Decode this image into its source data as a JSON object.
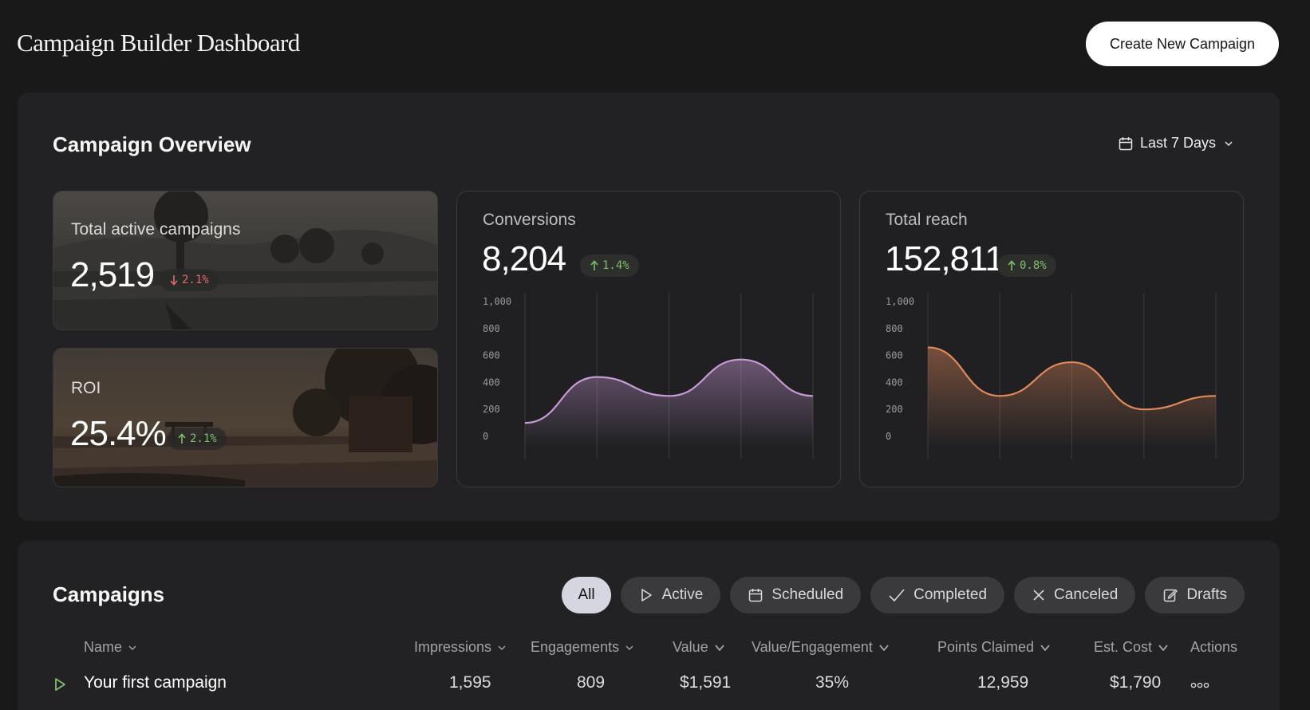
{
  "header": {
    "title": "Campaign Builder Dashboard",
    "create_button": "Create New Campaign"
  },
  "overview": {
    "title": "Campaign Overview",
    "date_range": "Last 7 Days",
    "active_campaigns": {
      "label": "Total active campaigns",
      "value": "2,519",
      "change": "2.1%",
      "direction": "down"
    },
    "roi": {
      "label": "ROI",
      "value": "25.4%",
      "change": "2.1%",
      "direction": "up"
    },
    "conversions": {
      "label": "Conversions",
      "value": "8,204",
      "change": "1.4%",
      "direction": "up"
    },
    "total_reach": {
      "label": "Total reach",
      "value": "152,811",
      "change": "0.8%",
      "direction": "up"
    }
  },
  "chart_data": [
    {
      "type": "area",
      "title": "Conversions",
      "y_ticks": [
        "1,000",
        "800",
        "600",
        "400",
        "200",
        "0"
      ],
      "ylim": [
        0,
        1000
      ],
      "x": [
        0,
        1,
        2,
        3,
        4
      ],
      "values": [
        100,
        440,
        300,
        570,
        300
      ],
      "color": "#c89ad6",
      "grid": "vertical"
    },
    {
      "type": "area",
      "title": "Total reach",
      "y_ticks": [
        "1,000",
        "800",
        "600",
        "400",
        "200",
        "0"
      ],
      "ylim": [
        0,
        1000
      ],
      "x": [
        0,
        1,
        2,
        3,
        4
      ],
      "values": [
        660,
        300,
        550,
        200,
        300
      ],
      "color": "#e0895c",
      "grid": "vertical"
    }
  ],
  "campaigns": {
    "title": "Campaigns",
    "filters": [
      {
        "label": "All",
        "icon": "none",
        "active": true
      },
      {
        "label": "Active",
        "icon": "play-icon",
        "active": false
      },
      {
        "label": "Scheduled",
        "icon": "calendar-icon",
        "active": false
      },
      {
        "label": "Completed",
        "icon": "check-icon",
        "active": false
      },
      {
        "label": "Canceled",
        "icon": "x-icon",
        "active": false
      },
      {
        "label": "Drafts",
        "icon": "edit-icon",
        "active": false
      }
    ],
    "columns": [
      "Name",
      "Impressions",
      "Engagements",
      "Value",
      "Value/Engagement",
      "Points Claimed",
      "Est. Cost",
      "Actions"
    ],
    "rows": [
      {
        "name": "Your first campaign",
        "impressions": "1,595",
        "engagements": "809",
        "value": "$1,591",
        "value_per_engagement": "35%",
        "points_claimed": "12,959",
        "est_cost": "$1,790",
        "actions": "more-icon"
      }
    ]
  },
  "colors": {
    "background": "#19191a",
    "panel": "#222224",
    "positive": "#7fbf6a",
    "negative": "#e06a6a"
  }
}
